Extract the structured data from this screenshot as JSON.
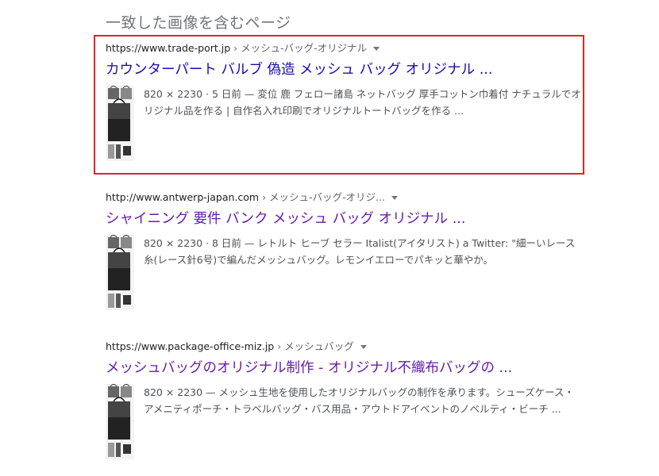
{
  "section_heading": "一致した画像を含むページ",
  "results": [
    {
      "url": "https://www.trade-port.jp",
      "crumb": " › メッシュ-バッグ-オリジナル",
      "title": "カウンターパート バルブ 偽造 メッシュ バッグ オリジナル ...",
      "snippet": "820 × 2230 · 5 日前 — 変位 鹿 フェロー諸島 ネットバッグ 厚手コットン巾着付 ナチュラルでオリジナル品を作る | 自作名入れ印刷でオリジナルトートバッグを作る ...",
      "highlighted": true,
      "title_color": "#1a0dab"
    },
    {
      "url": "http://www.antwerp-japan.com",
      "crumb": " › メッシュ-バッグ-オリジ...",
      "title": "シャイニング 要件 バンク メッシュ バッグ オリジナル ...",
      "snippet": "820 × 2230 · 8 日前 — レトルト ヒーブ セラー Italist(アイタリスト) a Twitter: \"細ーいレース糸(レース針6号)で編んだメッシュバッグ。レモンイエローでパキッと華やか。",
      "highlighted": false,
      "title_color": "#681da8"
    },
    {
      "url": "https://www.package-office-miz.jp",
      "crumb": " › メッシュバッグ",
      "title": "メッシュバッグのオリジナル制作 - オリジナル不織布バッグの ...",
      "snippet": "820 × 2230 — メッシュ生地を使用したオリジナルバッグの制作を承ります。シューズケース・アメニティポーチ・トラベルバッグ・バス用品・アウトドアイベントのノベルティ・ビーチ ...",
      "highlighted": false,
      "title_color": "#681da8"
    }
  ]
}
